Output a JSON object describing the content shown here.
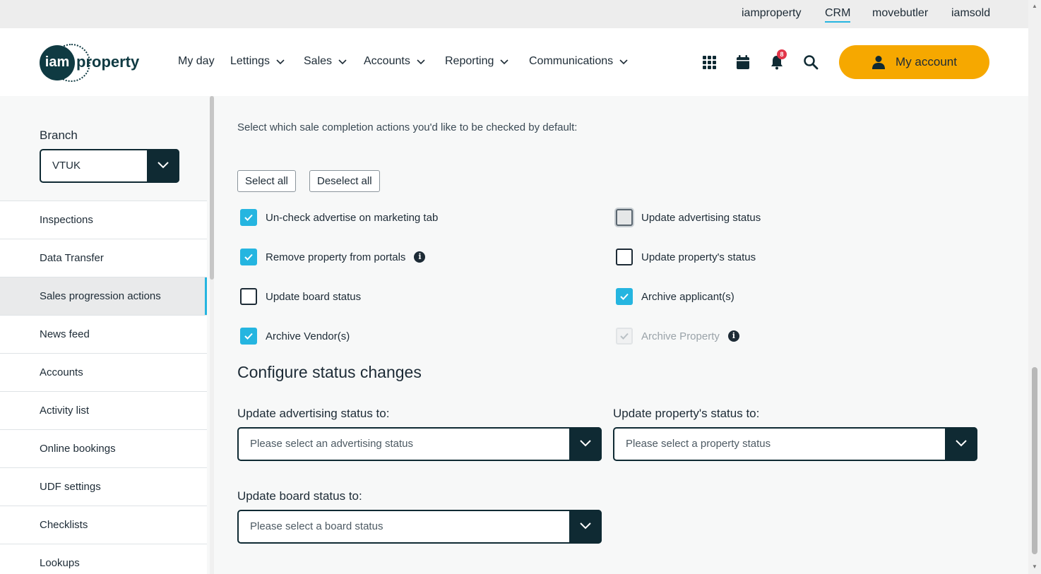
{
  "topbar": {
    "brands": [
      "iamproperty",
      "CRM",
      "movebutler",
      "iamsold"
    ],
    "active": "CRM"
  },
  "header": {
    "logo": {
      "circle": "iam",
      "word": "property"
    },
    "nav": [
      {
        "label": "My day",
        "dropdown": false
      },
      {
        "label": "Lettings",
        "dropdown": true
      },
      {
        "label": "Sales",
        "dropdown": true
      },
      {
        "label": "Accounts",
        "dropdown": true
      },
      {
        "label": "Reporting",
        "dropdown": true
      },
      {
        "label": "Communications",
        "dropdown": true
      }
    ],
    "notification_count": "8",
    "account_label": "My account"
  },
  "sidebar": {
    "branch_label": "Branch",
    "branch_value": "VTUK",
    "items": [
      "Inspections",
      "Data Transfer",
      "Sales progression actions",
      "News feed",
      "Accounts",
      "Activity list",
      "Online bookings",
      "UDF settings",
      "Checklists",
      "Lookups"
    ],
    "active_item": "Sales progression actions"
  },
  "main": {
    "intro": "Select which sale completion actions you'd like to be checked by default:",
    "select_all": "Select all",
    "deselect_all": "Deselect all",
    "actions": [
      {
        "label": "Un-check advertise on marketing tab",
        "checked": true,
        "state": "normal",
        "info": false
      },
      {
        "label": "Update advertising status",
        "checked": false,
        "state": "focus",
        "info": false
      },
      {
        "label": "Remove property from portals",
        "checked": true,
        "state": "normal",
        "info": true
      },
      {
        "label": "Update property's status",
        "checked": false,
        "state": "normal",
        "info": false
      },
      {
        "label": "Update board status",
        "checked": false,
        "state": "normal",
        "info": false
      },
      {
        "label": "Archive applicant(s)",
        "checked": true,
        "state": "normal",
        "info": false
      },
      {
        "label": "Archive Vendor(s)",
        "checked": true,
        "state": "normal",
        "info": false
      },
      {
        "label": "Archive Property",
        "checked": true,
        "state": "disabled",
        "info": true
      }
    ],
    "section_title": "Configure status changes",
    "advertising_label": "Update advertising status to:",
    "advertising_placeholder": "Please select an advertising status",
    "property_label": "Update property's status to:",
    "property_placeholder": "Please select a property status",
    "board_label": "Update board status to:",
    "board_placeholder": "Please select a board status"
  },
  "colors": {
    "accent": "#25b5e0",
    "brand_dark": "#0f2a33",
    "account_button": "#f6a800",
    "badge": "#e2364a"
  }
}
